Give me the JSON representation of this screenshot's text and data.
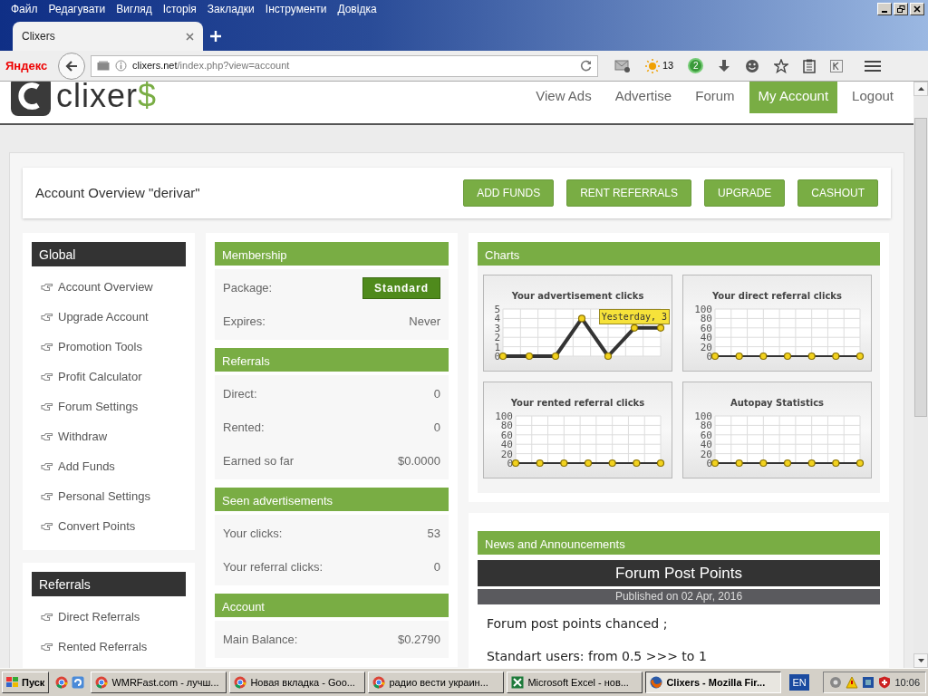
{
  "browser": {
    "menu": [
      "Файл",
      "Редагувати",
      "Вигляд",
      "Історія",
      "Закладки",
      "Інструменти",
      "Довідка"
    ],
    "tab": {
      "title": "Clixers",
      "selected": true
    },
    "toolbar": {
      "brand": "Яндекс",
      "url_host": "clixers.net",
      "url_path": "/index.php?view=account",
      "weather": "13",
      "badge": "2"
    }
  },
  "site": {
    "logo": {
      "text": "clixer",
      "accent": "$"
    },
    "nav": [
      {
        "label": "View Ads",
        "selected": false
      },
      {
        "label": "Advertise",
        "selected": false
      },
      {
        "label": "Forum",
        "selected": false
      },
      {
        "label": "My Account",
        "selected": true
      },
      {
        "label": "Logout",
        "selected": false
      }
    ]
  },
  "overview": {
    "title": "Account Overview \"derivar\"",
    "buttons": [
      "ADD FUNDS",
      "RENT REFERRALS",
      "UPGRADE",
      "CASHOUT"
    ]
  },
  "sidebar": [
    {
      "title": "Global",
      "items": [
        "Account Overview",
        "Upgrade Account",
        "Promotion Tools",
        "Profit Calculator",
        "Forum Settings",
        "Withdraw",
        "Add Funds",
        "Personal Settings",
        "Convert Points"
      ]
    },
    {
      "title": "Referrals",
      "items": [
        "Direct Referrals",
        "Rented Referrals"
      ]
    }
  ],
  "stats": [
    {
      "title": "Membership",
      "rows": [
        {
          "label": "Package:",
          "value": "Standard",
          "kind": "badge"
        },
        {
          "label": "Expires:",
          "value": "Never",
          "kind": "text"
        }
      ]
    },
    {
      "title": "Referrals",
      "rows": [
        {
          "label": "Direct:",
          "value": "0",
          "kind": "text"
        },
        {
          "label": "Rented:",
          "value": "0",
          "kind": "text"
        },
        {
          "label": "Earned so far",
          "value": "$0.0000",
          "kind": "text"
        }
      ]
    },
    {
      "title": "Seen advertisements",
      "rows": [
        {
          "label": "Your clicks:",
          "value": "53",
          "kind": "text"
        },
        {
          "label": "Your referral clicks:",
          "value": "0",
          "kind": "text"
        }
      ]
    },
    {
      "title": "Account",
      "rows": [
        {
          "label": "Main Balance:",
          "value": "$0.2790",
          "kind": "text"
        }
      ]
    }
  ],
  "charts": {
    "title": "Charts",
    "items": [
      {
        "tooltip": "Yesterday, 3",
        "chart_data": {
          "type": "line",
          "title": "Your advertisement clicks",
          "grid": true,
          "ylim": [
            0,
            5
          ],
          "yticks": [
            0,
            1,
            2,
            3,
            4,
            5
          ],
          "series": [
            {
              "color": "#333333",
              "marker": "circle",
              "values": [
                0,
                0,
                0,
                4,
                0,
                3,
                3
              ]
            }
          ]
        }
      },
      {
        "chart_data": {
          "type": "line",
          "title": "Your direct referral clicks",
          "grid": true,
          "ylim": [
            0,
            100
          ],
          "yticks": [
            0,
            20,
            40,
            60,
            80,
            100
          ],
          "series": [
            {
              "color": "#333333",
              "marker": "circle",
              "values": [
                0,
                0,
                0,
                0,
                0,
                0,
                0
              ]
            }
          ]
        }
      },
      {
        "chart_data": {
          "type": "line",
          "title": "Your rented referral clicks",
          "grid": true,
          "ylim": [
            0,
            100
          ],
          "yticks": [
            0,
            20,
            40,
            60,
            80,
            100
          ],
          "series": [
            {
              "color": "#333333",
              "marker": "circle",
              "values": [
                0,
                0,
                0,
                0,
                0,
                0,
                0
              ]
            }
          ]
        }
      },
      {
        "chart_data": {
          "type": "line",
          "title": "Autopay Statistics",
          "grid": true,
          "ylim": [
            0,
            100
          ],
          "yticks": [
            0,
            20,
            40,
            60,
            80,
            100
          ],
          "series": [
            {
              "color": "#333333",
              "marker": "circle",
              "values": [
                0,
                0,
                0,
                0,
                0,
                0,
                0
              ]
            }
          ]
        }
      }
    ]
  },
  "news": {
    "title": "News and Announcements",
    "post": {
      "title": "Forum Post Points",
      "date": "Published on 02 Apr, 2016",
      "body": [
        "Forum post points chanced ;",
        "Standart users: from 0.5 >>> to 1"
      ]
    }
  },
  "taskbar": {
    "start": "Пуск",
    "tasks": [
      {
        "label": "WMRFast.com - лучш...",
        "selected": false
      },
      {
        "label": "Новая вкладка - Goo...",
        "selected": false
      },
      {
        "label": "радио вести украин...",
        "selected": false
      },
      {
        "label": "Microsoft Excel - нов...",
        "selected": false
      },
      {
        "label": "Clixers - Mozilla Fir...",
        "selected": true
      }
    ],
    "lang": "EN",
    "clock": "10:06"
  }
}
